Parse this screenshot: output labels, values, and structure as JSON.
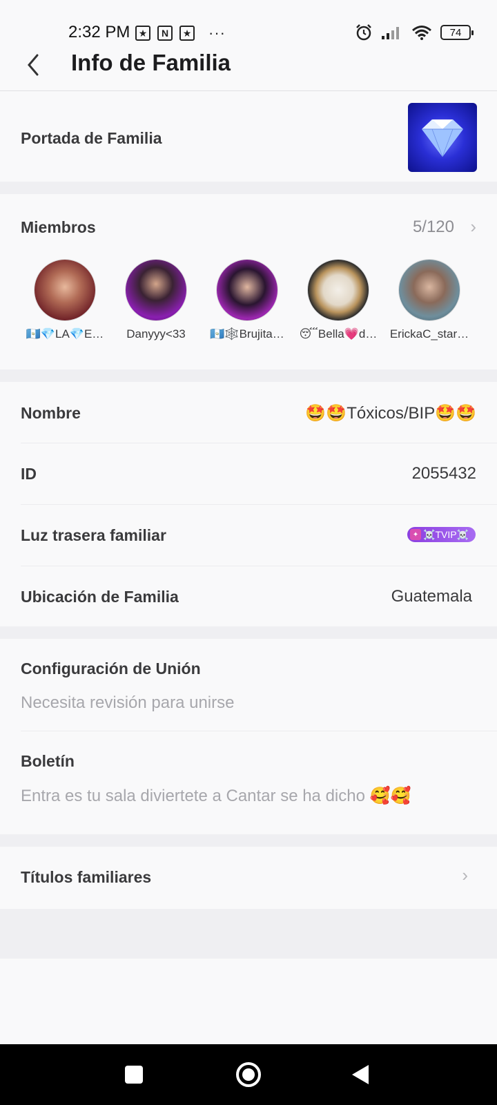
{
  "status_bar": {
    "time": "2:32 PM",
    "app_icons": [
      "star-badge-icon",
      "n-app-icon",
      "star-badge-icon"
    ],
    "overflow": "···",
    "battery": "74"
  },
  "header": {
    "title": "Info de Familia"
  },
  "cover": {
    "label": "Portada de Familia"
  },
  "members": {
    "label": "Miembros",
    "count": "5/120",
    "list": [
      {
        "name": "🇬🇹💎LA💎E…",
        "color": "#a23a3a"
      },
      {
        "name": "Danyyy<33",
        "color": "#6b1a8e"
      },
      {
        "name": "🇬🇹🕸️Brujita…",
        "color": "#7b1fa2"
      },
      {
        "name": "😴Bella💗d…",
        "color": "#2b2b2b"
      },
      {
        "name": "ErickaC_star…",
        "color": "#5a7a8a"
      }
    ]
  },
  "info": {
    "name_label": "Nombre",
    "name_value": "🤩🤩Tóxicos/BIP🤩🤩",
    "id_label": "ID",
    "id_value": "2055432",
    "backlight_label": "Luz trasera familiar",
    "backlight_badge": "☠️TVIP☠️",
    "location_label": "Ubicación de Familia",
    "location_value": "Guatemala"
  },
  "join": {
    "label": "Configuración de Unión",
    "value": "Necesita revisión para unirse"
  },
  "bulletin": {
    "label": "Boletín",
    "value": "Entra es tu sala diviertete a Cantar se ha dicho 🥰🥰"
  },
  "titles": {
    "label": "Títulos familiares"
  },
  "colors": {
    "background": "#f9f9fa",
    "separator": "#efeff2",
    "badge": "#9b55ea"
  }
}
